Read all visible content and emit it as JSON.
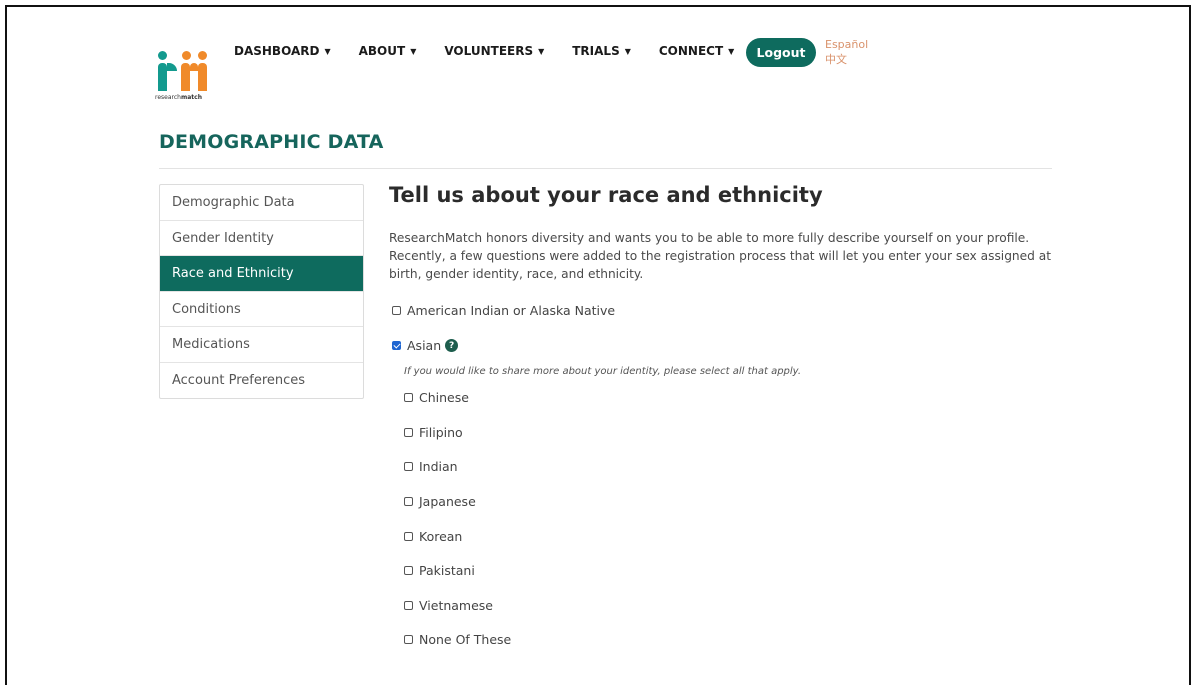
{
  "header": {
    "brand_prefix": "research",
    "brand_suffix": "match",
    "nav": [
      {
        "label": "DASHBOARD"
      },
      {
        "label": "ABOUT"
      },
      {
        "label": "VOLUNTEERS"
      },
      {
        "label": "TRIALS"
      },
      {
        "label": "CONNECT"
      }
    ],
    "logout_label": "Logout",
    "languages": [
      "Español",
      "中文"
    ]
  },
  "page": {
    "title": "DEMOGRAPHIC DATA"
  },
  "sidebar": {
    "items": [
      {
        "label": "Demographic Data"
      },
      {
        "label": "Gender Identity"
      },
      {
        "label": "Race and Ethnicity"
      },
      {
        "label": "Conditions"
      },
      {
        "label": "Medications"
      },
      {
        "label": "Account Preferences"
      }
    ],
    "active_index": 2
  },
  "main": {
    "heading": "Tell us about your race and ethnicity",
    "intro": "ResearchMatch honors diversity and wants you to be able to more fully describe yourself on your profile. Recently, a few questions were added to the registration process that will let you enter your sex assigned at birth, gender identity, race, and ethnicity.",
    "options": [
      {
        "label": "American Indian or Alaska Native",
        "checked": false
      },
      {
        "label": "Asian",
        "checked": true
      }
    ],
    "help_glyph": "?",
    "sub_hint": "If you would like to share more about your identity, please select all that apply.",
    "sub_options": [
      {
        "label": "Chinese",
        "checked": false
      },
      {
        "label": "Filipino",
        "checked": false
      },
      {
        "label": "Indian",
        "checked": false
      },
      {
        "label": "Japanese",
        "checked": false
      },
      {
        "label": "Korean",
        "checked": false
      },
      {
        "label": "Pakistani",
        "checked": false
      },
      {
        "label": "Vietnamese",
        "checked": false
      },
      {
        "label": "None Of These",
        "checked": false
      }
    ]
  },
  "colors": {
    "brand_green": "#0e6b5e",
    "title_green": "#16655c",
    "logo_orange": "#f08a2a",
    "logo_teal": "#139a8e",
    "lang_orange": "#d9926b"
  },
  "icons": {
    "logo": "researchmatch-logo-icon",
    "nav_caret": "caret-down-icon",
    "help": "question-circle-icon",
    "checkbox_checked": "check-icon"
  }
}
